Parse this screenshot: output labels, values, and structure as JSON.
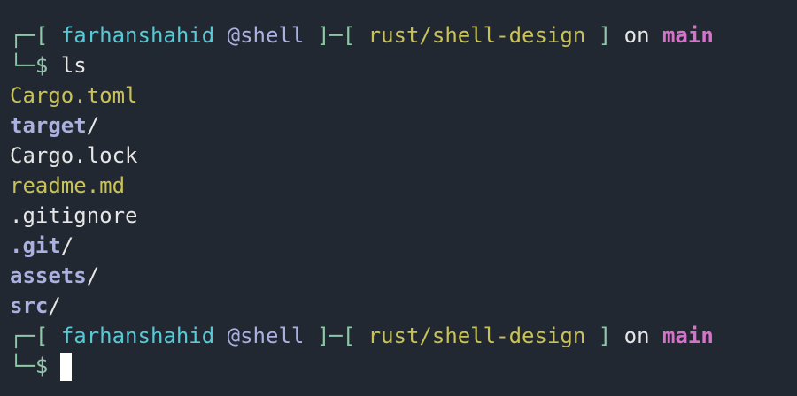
{
  "prompt1": {
    "top_left": "┌─[",
    "user": "farhanshahid",
    "host": "@shell",
    "mid": "]─[",
    "path": "rust/shell-design",
    "close": "]",
    "on": "on",
    "branch": "main",
    "corner": "└─$",
    "command": "ls"
  },
  "files": [
    {
      "name": "Cargo.toml",
      "slash": "",
      "kind": "file-yellow"
    },
    {
      "name": "target",
      "slash": "/",
      "kind": "dir"
    },
    {
      "name": "Cargo.lock",
      "slash": "",
      "kind": "file-plain"
    },
    {
      "name": "readme.md",
      "slash": "",
      "kind": "file-yellow"
    },
    {
      "name": ".gitignore",
      "slash": "",
      "kind": "file-plain"
    },
    {
      "name": ".git",
      "slash": "/",
      "kind": "dir"
    },
    {
      "name": "assets",
      "slash": "/",
      "kind": "dir"
    },
    {
      "name": "src",
      "slash": "/",
      "kind": "dir"
    }
  ],
  "prompt2": {
    "top_left": "┌─[",
    "user": "farhanshahid",
    "host": "@shell",
    "mid": "]─[",
    "path": "rust/shell-design",
    "close": "]",
    "on": "on",
    "branch": "main",
    "corner": "└─$"
  },
  "colors": {
    "background": "#222831",
    "user": "#58c9d6",
    "host": "#aab0e0",
    "path": "#c8c257",
    "branch": "#d672c9",
    "box": "#8fc8a8"
  }
}
